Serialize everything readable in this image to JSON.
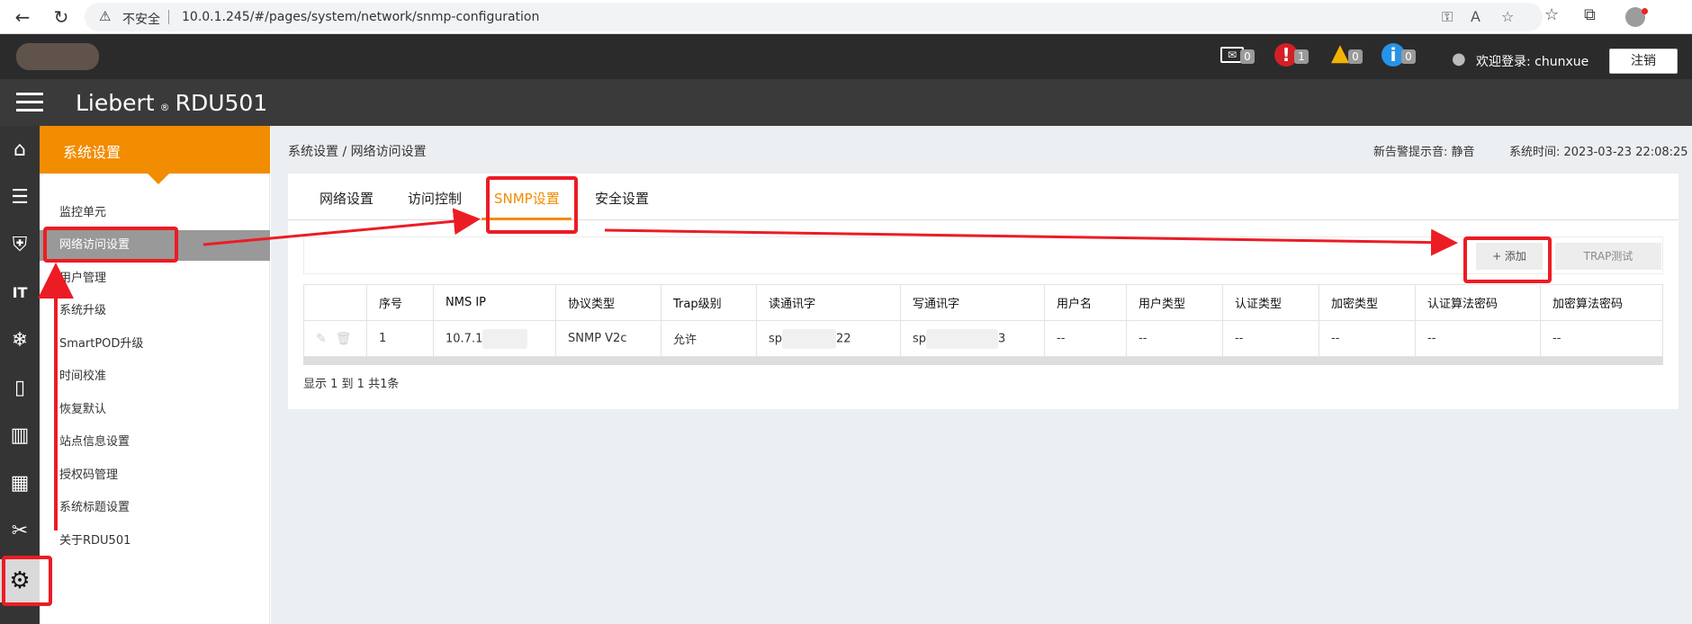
{
  "browser": {
    "insecure_label": "不安全",
    "url": "10.0.1.245/#/pages/system/network/snmp-configuration"
  },
  "header": {
    "alerts": [
      {
        "icon": "mail-icon",
        "count": "0"
      },
      {
        "icon": "critical-alarm-icon",
        "count": "1",
        "glyph": "!"
      },
      {
        "icon": "warning-alarm-icon",
        "count": "0",
        "glyph": "▲"
      },
      {
        "icon": "info-alarm-icon",
        "count": "0",
        "glyph": "i"
      }
    ],
    "welcome": "欢迎登录: chunxue",
    "logout_label": "注销"
  },
  "title_bar": {
    "brand": "Liebert",
    "reg": "®",
    "model": "RDU501"
  },
  "icon_bar": [
    {
      "name": "home-icon",
      "glyph": "⌂"
    },
    {
      "name": "server-icon",
      "glyph": "☰"
    },
    {
      "name": "shield-icon",
      "glyph": "⛨"
    },
    {
      "name": "it-icon",
      "glyph": "IT"
    },
    {
      "name": "snowflake-icon",
      "glyph": "❄"
    },
    {
      "name": "battery-icon",
      "glyph": "▯"
    },
    {
      "name": "bar-chart-icon",
      "glyph": "▥"
    },
    {
      "name": "layout-icon",
      "glyph": "▦"
    },
    {
      "name": "tools-icon",
      "glyph": "✂"
    },
    {
      "name": "gear-icon",
      "glyph": "⚙",
      "active": true
    }
  ],
  "sub_menu": {
    "title": "系统设置",
    "items": [
      {
        "label": "监控单元"
      },
      {
        "label": "网络访问设置",
        "active": true
      },
      {
        "label": "用户管理"
      },
      {
        "label": "系统升级"
      },
      {
        "label": "SmartPOD升级"
      },
      {
        "label": "时间校准"
      },
      {
        "label": "恢复默认"
      },
      {
        "label": "站点信息设置"
      },
      {
        "label": "授权码管理"
      },
      {
        "label": "系统标题设置"
      },
      {
        "label": "关于RDU501"
      }
    ]
  },
  "main": {
    "breadcrumb": "系统设置 / 网络访问设置",
    "alert_sound": "新告警提示音: 静音",
    "system_time": "系统时间: 2023-03-23 22:08:25",
    "tabs": [
      {
        "label": "网络设置"
      },
      {
        "label": "访问控制"
      },
      {
        "label": "SNMP设置",
        "active": true
      },
      {
        "label": "安全设置"
      }
    ],
    "add_label": "+ 添加",
    "trap_label": "TRAP测试",
    "table": {
      "headers": [
        "",
        "序号",
        "NMS IP",
        "协议类型",
        "Trap级别",
        "读通讯字",
        "写通讯字",
        "用户名",
        "用户类型",
        "认证类型",
        "加密类型",
        "认证算法密码",
        "加密算法密码"
      ],
      "rows": [
        {
          "index": "1",
          "nms_ip": "10.7.1",
          "protocol": "SNMP V2c",
          "trap": "允许",
          "read_prefix": "sp",
          "read_suffix": "22",
          "write_prefix": "sp",
          "write_suffix": "3",
          "user": "--",
          "user_type": "--",
          "auth": "--",
          "enc": "--",
          "auth_pwd": "--",
          "enc_pwd": "--"
        }
      ]
    },
    "pager": "显示 1 到 1 共1条"
  },
  "colors": {
    "accent": "#f28c00",
    "annotation": "#ec1c24",
    "header_dark": "#2b2b2b",
    "titlebar": "#3a3a3a"
  }
}
